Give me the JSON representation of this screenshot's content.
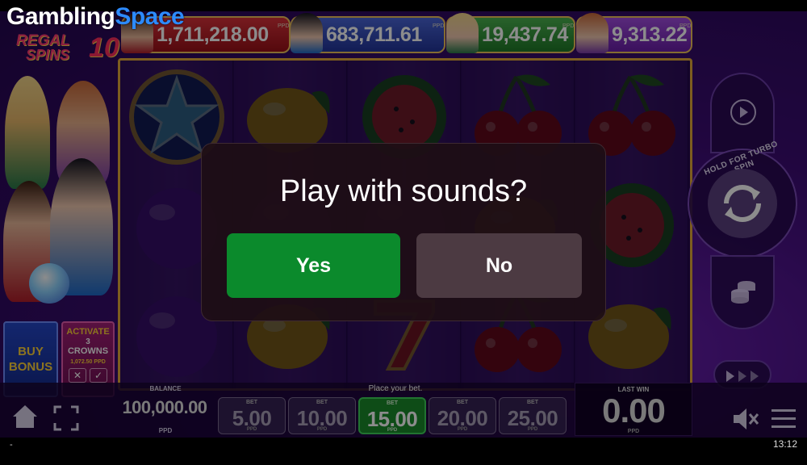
{
  "watermark": {
    "part1": "Gambling",
    "part2": "Space"
  },
  "logo": {
    "line1": "REGAL",
    "line2": "SPINS",
    "number": "10"
  },
  "jackpots": [
    {
      "amount": "1,711,218.00",
      "unit": "PPD",
      "color": "#c0222b"
    },
    {
      "amount": "683,711.61",
      "unit": "PPD",
      "color": "#3050c0"
    },
    {
      "amount": "19,437.74",
      "unit": "PPD",
      "color": "#2f9a38"
    },
    {
      "amount": "9,313.22",
      "unit": "PPD",
      "color": "#8a36c8"
    }
  ],
  "buy_bonus": {
    "line1": "BUY",
    "line2": "BONUS"
  },
  "activate": {
    "line1": "ACTIVATE",
    "line2": "3",
    "line3": "CROWNS",
    "price": "1,072.50 PPD"
  },
  "reels": [
    [
      "star",
      "plum",
      "plum"
    ],
    [
      "lemon",
      "plum",
      "lemon"
    ],
    [
      "watermelon",
      "plum",
      "seven"
    ],
    [
      "cherry",
      "lemon",
      "cherry"
    ],
    [
      "cherry",
      "watermelon",
      "lemon"
    ]
  ],
  "turbo_text": "HOLD FOR TURBO SPIN",
  "balance": {
    "label": "BALANCE",
    "value": "100,000.00",
    "unit": "PPD"
  },
  "place_bet": "Place your bet.",
  "bets": [
    {
      "label": "BET",
      "value": "5.00",
      "unit": "PPD",
      "selected": false
    },
    {
      "label": "BET",
      "value": "10.00",
      "unit": "PPD",
      "selected": false
    },
    {
      "label": "BET",
      "value": "15.00",
      "unit": "PPD",
      "selected": true
    },
    {
      "label": "BET",
      "value": "20.00",
      "unit": "PPD",
      "selected": false
    },
    {
      "label": "BET",
      "value": "25.00",
      "unit": "PPD",
      "selected": false
    }
  ],
  "last_win": {
    "label": "LAST WIN",
    "value": "0.00",
    "unit": "PPD"
  },
  "dialog": {
    "question": "Play with sounds?",
    "yes_label": "Yes",
    "no_label": "No"
  },
  "status_bar": {
    "left": "-",
    "time": "13:12"
  },
  "colors": {
    "accent_green": "#0b8a2c",
    "frame_gold": "#e3a93a",
    "bg_purple": "#3c0c74"
  }
}
